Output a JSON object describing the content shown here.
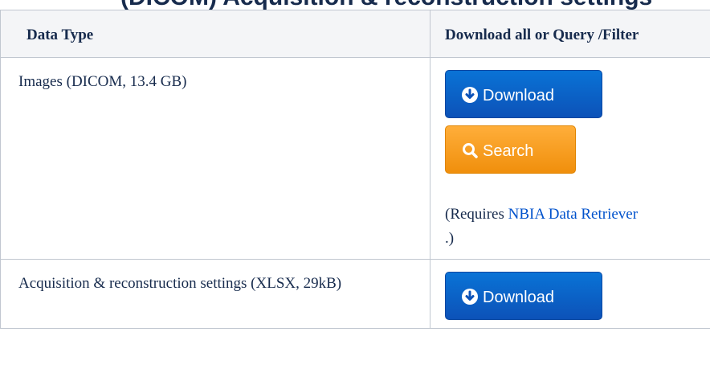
{
  "page": {
    "heading_fragment": "(DICOM) Acquisition & reconstruction settings",
    "table": {
      "headers": [
        "Data Type",
        "Download all or Query /Filter"
      ],
      "rows": [
        {
          "data_type": "Images (DICOM, 13.4 GB)",
          "buttons": {
            "download_label": "Download",
            "search_label": "Search"
          },
          "note_prefix": "(Requires ",
          "note_link": "NBIA Data Retriever",
          "note_suffix": ".)"
        },
        {
          "data_type": "Acquisition & reconstruction settings (XLSX, 29kB)",
          "buttons": {
            "download_label": "Download"
          }
        }
      ]
    }
  },
  "colors": {
    "download_button": "#0c52b8",
    "search_button": "#f39a1b",
    "link": "#0052cc",
    "header_bg": "#f4f5f7",
    "border": "#c1c7d0"
  },
  "icons": {
    "download": "circle-down-arrow-icon",
    "search": "magnifier-icon"
  }
}
